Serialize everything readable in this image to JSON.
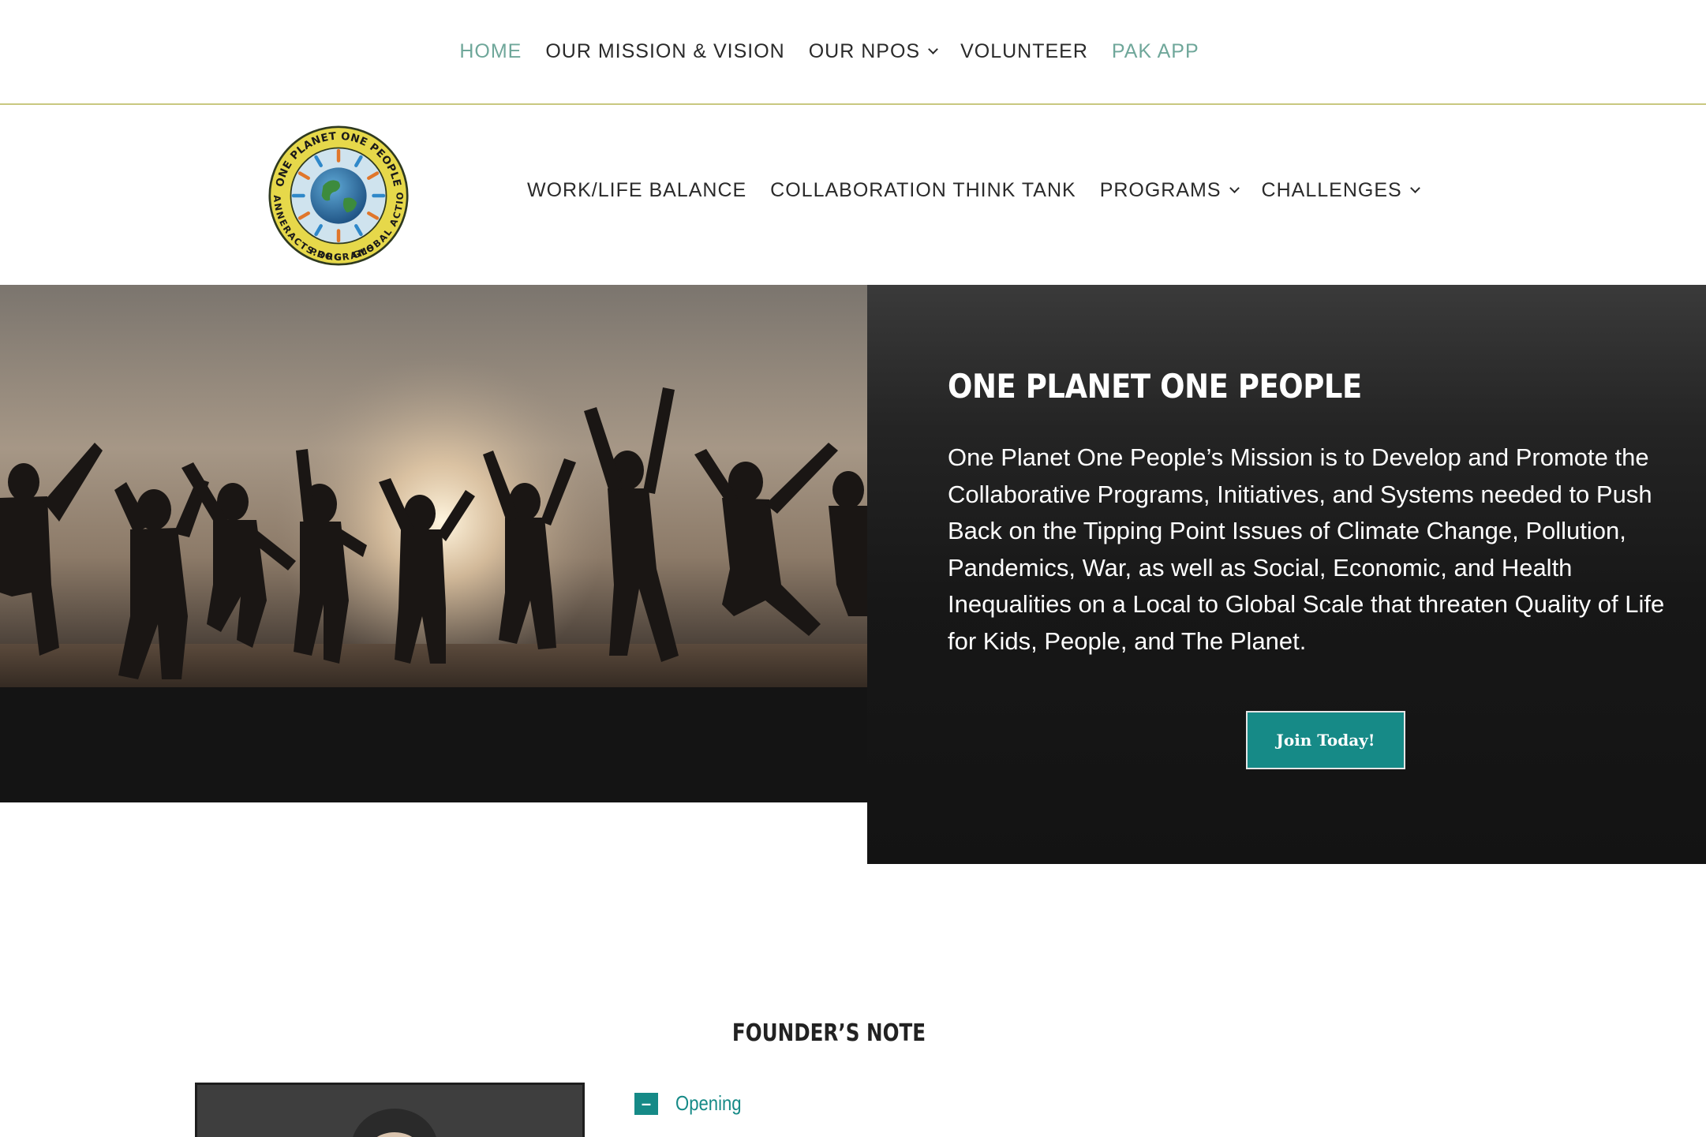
{
  "topnav": {
    "items": [
      {
        "label": "HOME",
        "accent": true
      },
      {
        "label": "OUR MISSION & VISION"
      },
      {
        "label": "OUR NPOS",
        "dropdown": true
      },
      {
        "label": "VOLUNTEER"
      },
      {
        "label": "PAK APP",
        "accent": true
      }
    ]
  },
  "logo": {
    "text_top": "ONE PLANET ONE PEOPLE",
    "text_right": "GLOBAL ACTION",
    "text_bottom": "PROGRAMS",
    "text_left": "PLANNERACTS.ORG"
  },
  "mainnav": {
    "items": [
      {
        "label": "WORK/LIFE BALANCE"
      },
      {
        "label": "COLLABORATION THINK TANK"
      },
      {
        "label": "PROGRAMS",
        "dropdown": true
      },
      {
        "label": "CHALLENGES",
        "dropdown": true
      }
    ]
  },
  "hero": {
    "title": "ONE PLANET ONE PEOPLE",
    "text": "One Planet One People’s Mission is to Develop and Promote the Collaborative Programs, Initiatives, and Systems needed to Push Back on the Tipping Point Issues of Climate Change, Pollution, Pandemics, War, as well as Social, Economic, and Health Inequalities on a Local to Global Scale that threaten Quality of Life for Kids, People, and The Planet.",
    "button_label": "Join Today!"
  },
  "founder": {
    "title": "FOUNDER’S NOTE",
    "accordion": [
      {
        "label": "Opening",
        "toggle": "–"
      }
    ]
  },
  "colors": {
    "accent_teal": "#168a87",
    "nav_accent": "#6fa79a",
    "divider_gold": "#c9c880",
    "hero_dark": "#141414"
  }
}
